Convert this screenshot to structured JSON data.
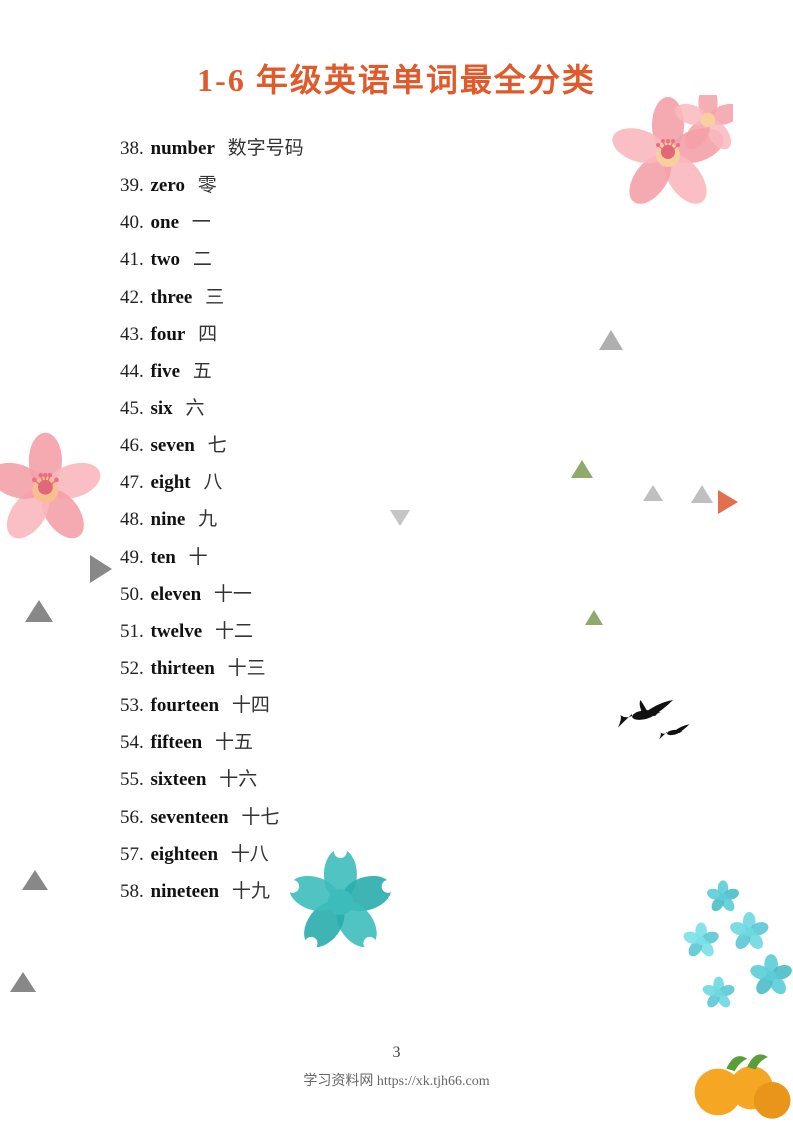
{
  "title": "1-6 年级英语单词最全分类",
  "words": [
    {
      "num": "38.",
      "en": "number",
      "cn": "数字号码"
    },
    {
      "num": "39.",
      "en": "zero",
      "cn": "零"
    },
    {
      "num": "40.",
      "en": "one",
      "cn": "一"
    },
    {
      "num": "41.",
      "en": "two",
      "cn": "二"
    },
    {
      "num": "42.",
      "en": "three",
      "cn": "三"
    },
    {
      "num": "43.",
      "en": "four",
      "cn": "四"
    },
    {
      "num": "44.",
      "en": "five",
      "cn": "五"
    },
    {
      "num": "45.",
      "en": "six",
      "cn": "六"
    },
    {
      "num": "46.",
      "en": "seven",
      "cn": "七"
    },
    {
      "num": "47.",
      "en": "eight",
      "cn": "八"
    },
    {
      "num": "48.",
      "en": "nine",
      "cn": "九"
    },
    {
      "num": "49.",
      "en": "ten",
      "cn": "十"
    },
    {
      "num": "50.",
      "en": "eleven",
      "cn": "十一"
    },
    {
      "num": "51.",
      "en": "twelve",
      "cn": "十二"
    },
    {
      "num": "52.",
      "en": "thirteen",
      "cn": "十三"
    },
    {
      "num": "53.",
      "en": "fourteen",
      "cn": "十四"
    },
    {
      "num": "54.",
      "en": "fifteen",
      "cn": "十五"
    },
    {
      "num": "55.",
      "en": "sixteen",
      "cn": "十六"
    },
    {
      "num": "56.",
      "en": "seventeen",
      "cn": "十七"
    },
    {
      "num": "57.",
      "en": "eighteen",
      "cn": "十八"
    },
    {
      "num": "58.",
      "en": "nineteen",
      "cn": "十九"
    }
  ],
  "page_number": "3",
  "footer": "学习资料网 https://xk.tjh66.com"
}
